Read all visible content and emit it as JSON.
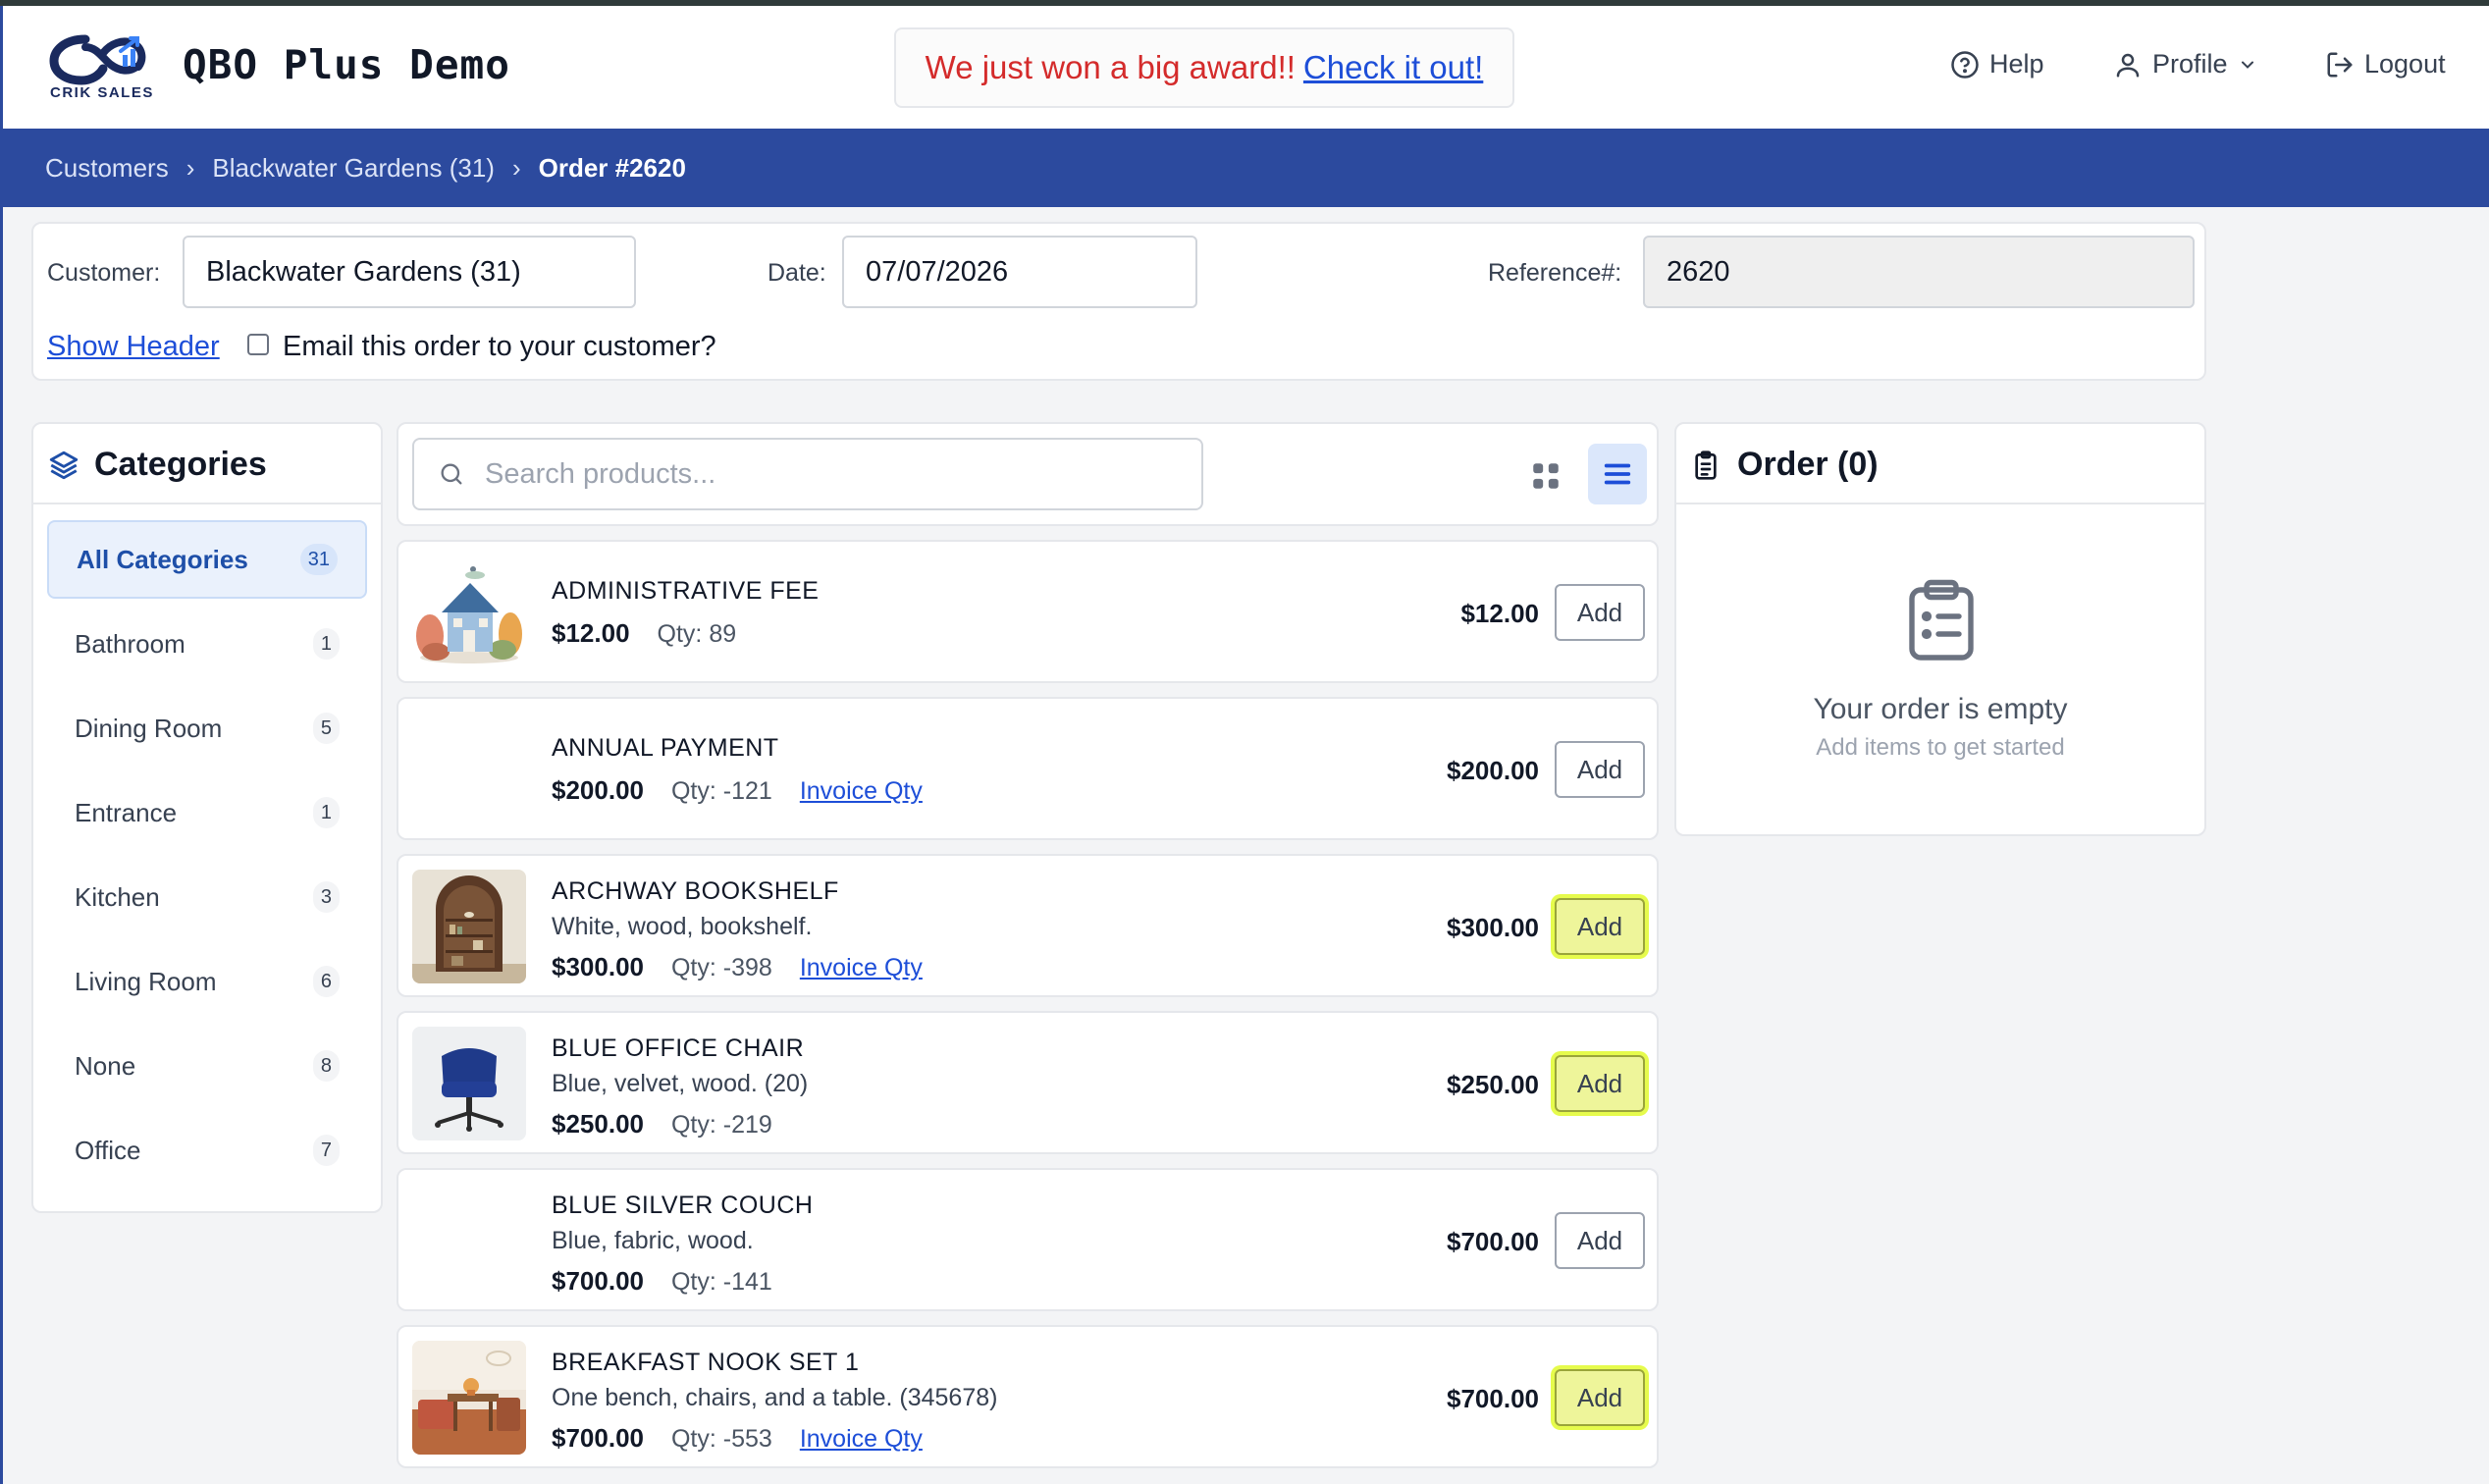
{
  "app": {
    "title": "QBO Plus Demo",
    "logo_text": "CRIK SALES",
    "award_text": "We just won a big award!!",
    "award_link": "Check it out!"
  },
  "nav": {
    "help": "Help",
    "profile": "Profile",
    "logout": "Logout"
  },
  "breadcrumb": [
    "Customers",
    "Blackwater Gardens (31)",
    "Order #2620"
  ],
  "breadcrumb_separator": "›",
  "order_header": {
    "customer_label": "Customer:",
    "customer_value": "Blackwater Gardens (31)",
    "date_label": "Date:",
    "date_value": "07/07/2026",
    "reference_label": "Reference#:",
    "reference_value": "2620",
    "show_header": "Show Header",
    "email_label": "Email this order to your customer?"
  },
  "categories": {
    "title": "Categories",
    "items": [
      {
        "label": "All Categories",
        "count": "31"
      },
      {
        "label": "Bathroom",
        "count": "1"
      },
      {
        "label": "Dining Room",
        "count": "5"
      },
      {
        "label": "Entrance",
        "count": "1"
      },
      {
        "label": "Kitchen",
        "count": "3"
      },
      {
        "label": "Living Room",
        "count": "6"
      },
      {
        "label": "None",
        "count": "8"
      },
      {
        "label": "Office",
        "count": "7"
      }
    ]
  },
  "search": {
    "placeholder": "Search products..."
  },
  "products": [
    {
      "name": "ADMINISTRATIVE FEE",
      "desc": "",
      "price": "$12.00",
      "qty": "Qty: 89",
      "invoice": "",
      "add": "Add",
      "image": "house-illustration"
    },
    {
      "name": "ANNUAL PAYMENT",
      "desc": "",
      "price": "$200.00",
      "qty": "Qty: -121",
      "invoice": "Invoice Qty",
      "add": "Add",
      "image": "none"
    },
    {
      "name": "ARCHWAY BOOKSHELF",
      "desc": "White, wood, bookshelf.",
      "price": "$300.00",
      "qty": "Qty: -398",
      "invoice": "Invoice Qty",
      "add": "Add",
      "image": "bookshelf-photo"
    },
    {
      "name": "BLUE OFFICE CHAIR",
      "desc": "Blue, velvet, wood. (20)",
      "price": "$250.00",
      "qty": "Qty: -219",
      "invoice": "",
      "add": "Add",
      "image": "chair-photo"
    },
    {
      "name": "BLUE SILVER COUCH",
      "desc": "Blue, fabric, wood.",
      "price": "$700.00",
      "qty": "Qty: -141",
      "invoice": "",
      "add": "Add",
      "image": "none"
    },
    {
      "name": "BREAKFAST NOOK SET 1",
      "desc": "One bench, chairs, and a table. (345678)",
      "price": "$700.00",
      "qty": "Qty: -553",
      "invoice": "Invoice Qty",
      "add": "Add",
      "image": "nook-photo"
    }
  ],
  "order": {
    "title": "Order (0)",
    "empty_title": "Your order is empty",
    "empty_sub": "Add items to get started"
  },
  "colors": {
    "brand_blue": "#2c4a9e",
    "award_red": "#d42b2b",
    "link_blue": "#1d4ed8",
    "highlight": "#e6fb4c"
  }
}
